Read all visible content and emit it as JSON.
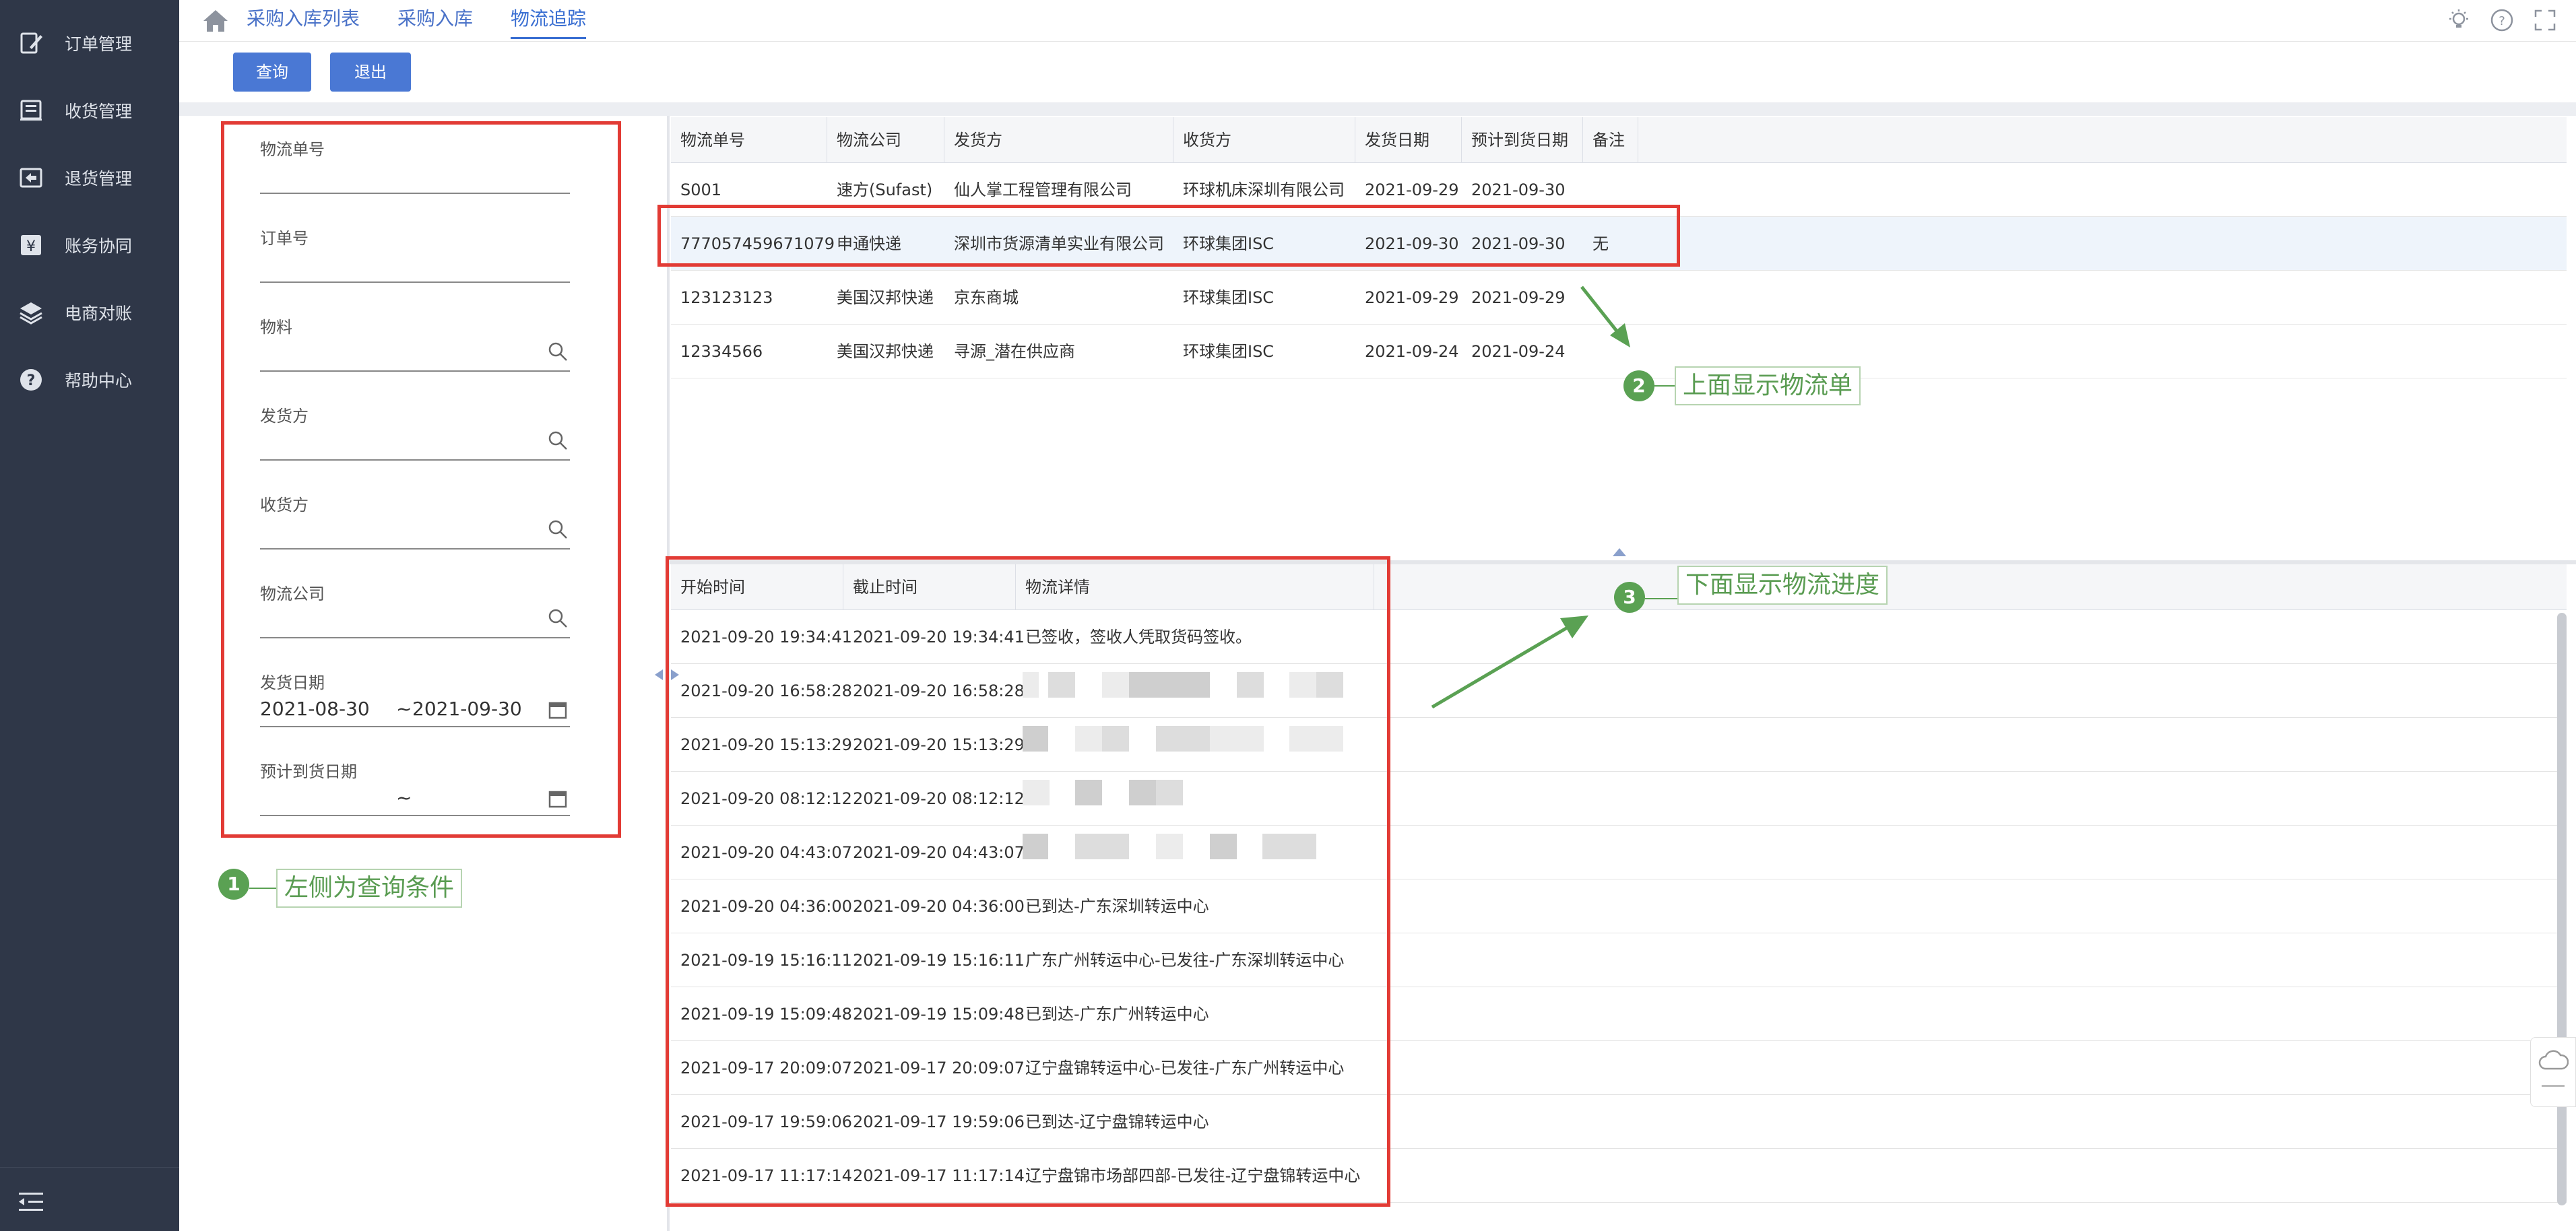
{
  "sidebar": {
    "items": [
      {
        "label": "订单管理",
        "icon": "edit-icon"
      },
      {
        "label": "收货管理",
        "icon": "inbox-icon"
      },
      {
        "label": "退货管理",
        "icon": "return-icon"
      },
      {
        "label": "账务协同",
        "icon": "yen-icon"
      },
      {
        "label": "电商对账",
        "icon": "layers-icon"
      },
      {
        "label": "帮助中心",
        "icon": "help-icon"
      }
    ]
  },
  "topbar": {
    "tabs": [
      "采购入库列表",
      "采购入库",
      "物流追踪"
    ],
    "active_tab": "物流追踪"
  },
  "toolbar": {
    "query_label": "查询",
    "exit_label": "退出"
  },
  "filters": {
    "logistics_no_label": "物流单号",
    "order_no_label": "订单号",
    "material_label": "物料",
    "shipper_label": "发货方",
    "receiver_label": "收货方",
    "logistics_company_label": "物流公司",
    "ship_date_label": "发货日期",
    "ship_date_from": "2021-08-30",
    "ship_date_sep": "~",
    "ship_date_to": "2021-09-30",
    "eta_label": "预计到货日期",
    "eta_sep": "~"
  },
  "annotations": {
    "a1": {
      "num": "1",
      "text": "左侧为查询条件"
    },
    "a2": {
      "num": "2",
      "text": "上面显示物流单"
    },
    "a3": {
      "num": "3",
      "text": "下面显示物流进度"
    }
  },
  "shipments": {
    "columns": [
      "物流单号",
      "物流公司",
      "发货方",
      "收货方",
      "发货日期",
      "预计到货日期",
      "备注"
    ],
    "rows": [
      [
        "S001",
        "速方(Sufast)",
        "仙人掌工程管理有限公司",
        "环球机床深圳有限公司",
        "2021-09-29",
        "2021-09-30",
        ""
      ],
      [
        "777057459671079",
        "申通快递",
        "深圳市货源清单实业有限公司",
        "环球集团ISC",
        "2021-09-30",
        "2021-09-30",
        "无"
      ],
      [
        "123123123",
        "美国汉邦快递",
        "京东商城",
        "环球集团ISC",
        "2021-09-29",
        "2021-09-29",
        ""
      ],
      [
        "12334566",
        "美国汉邦快递",
        "寻源_潜在供应商",
        "环球集团ISC",
        "2021-09-24",
        "2021-09-24",
        ""
      ]
    ]
  },
  "tracking": {
    "columns": [
      "开始时间",
      "截止时间",
      "物流详情"
    ],
    "rows": [
      [
        "2021-09-20 19:34:41",
        "2021-09-20 19:34:41",
        "已签收，签收人凭取货码签收。"
      ],
      [
        "2021-09-20 16:58:28",
        "2021-09-20 16:58:28",
        ""
      ],
      [
        "2021-09-20 15:13:29",
        "2021-09-20 15:13:29",
        ""
      ],
      [
        "2021-09-20 08:12:12",
        "2021-09-20 08:12:12",
        ""
      ],
      [
        "2021-09-20 04:43:07",
        "2021-09-20 04:43:07",
        ""
      ],
      [
        "2021-09-20 04:36:00",
        "2021-09-20 04:36:00",
        "已到达-广东深圳转运中心"
      ],
      [
        "2021-09-19 15:16:11",
        "2021-09-19 15:16:11",
        "广东广州转运中心-已发往-广东深圳转运中心"
      ],
      [
        "2021-09-19 15:09:48",
        "2021-09-19 15:09:48",
        "已到达-广东广州转运中心"
      ],
      [
        "2021-09-17 20:09:07",
        "2021-09-17 20:09:07",
        "辽宁盘锦转运中心-已发往-广东广州转运中心"
      ],
      [
        "2021-09-17 19:59:06",
        "2021-09-17 19:59:06",
        "已到达-辽宁盘锦转运中心"
      ],
      [
        "2021-09-17 11:17:14",
        "2021-09-17 11:17:14",
        "辽宁盘锦市场部四部-已发往-辽宁盘锦转运中心"
      ]
    ]
  },
  "colors": {
    "sidebar_bg": "#2f3748",
    "accent": "#4a78d4",
    "annotation_red": "#e23b35",
    "annotation_green": "#5aa153"
  }
}
